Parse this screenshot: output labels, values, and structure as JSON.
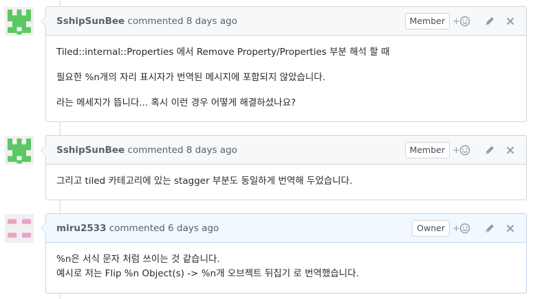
{
  "comments": [
    {
      "author": "SshipSunBee",
      "action": "commented",
      "time": "8 days ago",
      "role": "Member",
      "avatar_color": "#5cc863",
      "paragraphs": [
        "Tiled::internal::Properties 에서 Remove Property/Properties 부분 해석 할 때",
        "필요한 %n개의 자리 표시자가 번역된 메시지에 포함되지 않았습니다.",
        "라는 메세지가 뜹니다... 혹시 이런 경우 어떻게 해결하셨나요?"
      ]
    },
    {
      "author": "SshipSunBee",
      "action": "commented",
      "time": "8 days ago",
      "role": "Member",
      "avatar_color": "#5cc863",
      "paragraphs": [
        "그리고 tiled 카테고리에 있는 stagger 부분도 동일하게 번역해 두었습니다."
      ]
    },
    {
      "author": "miru2533",
      "action": "commented",
      "time": "6 days ago",
      "role": "Owner",
      "avatar_color": "#e8a3c8",
      "paragraphs": [
        "%n은 서식 문자 처럼 쓰이는 것 같습니다.",
        "예시로 저는 Flip %n Object(s) -> %n개 오브젝트 뒤집기 로 번역했습니다."
      ]
    }
  ],
  "icons": {
    "reaction": "smiley-plus-icon",
    "edit": "pencil-icon",
    "delete": "close-icon"
  },
  "colors": {
    "header_bg": "#f6f8fa",
    "owner_header_bg": "#f1f8ff",
    "border": "#d1d5da",
    "owner_border": "#c0d3eb"
  }
}
